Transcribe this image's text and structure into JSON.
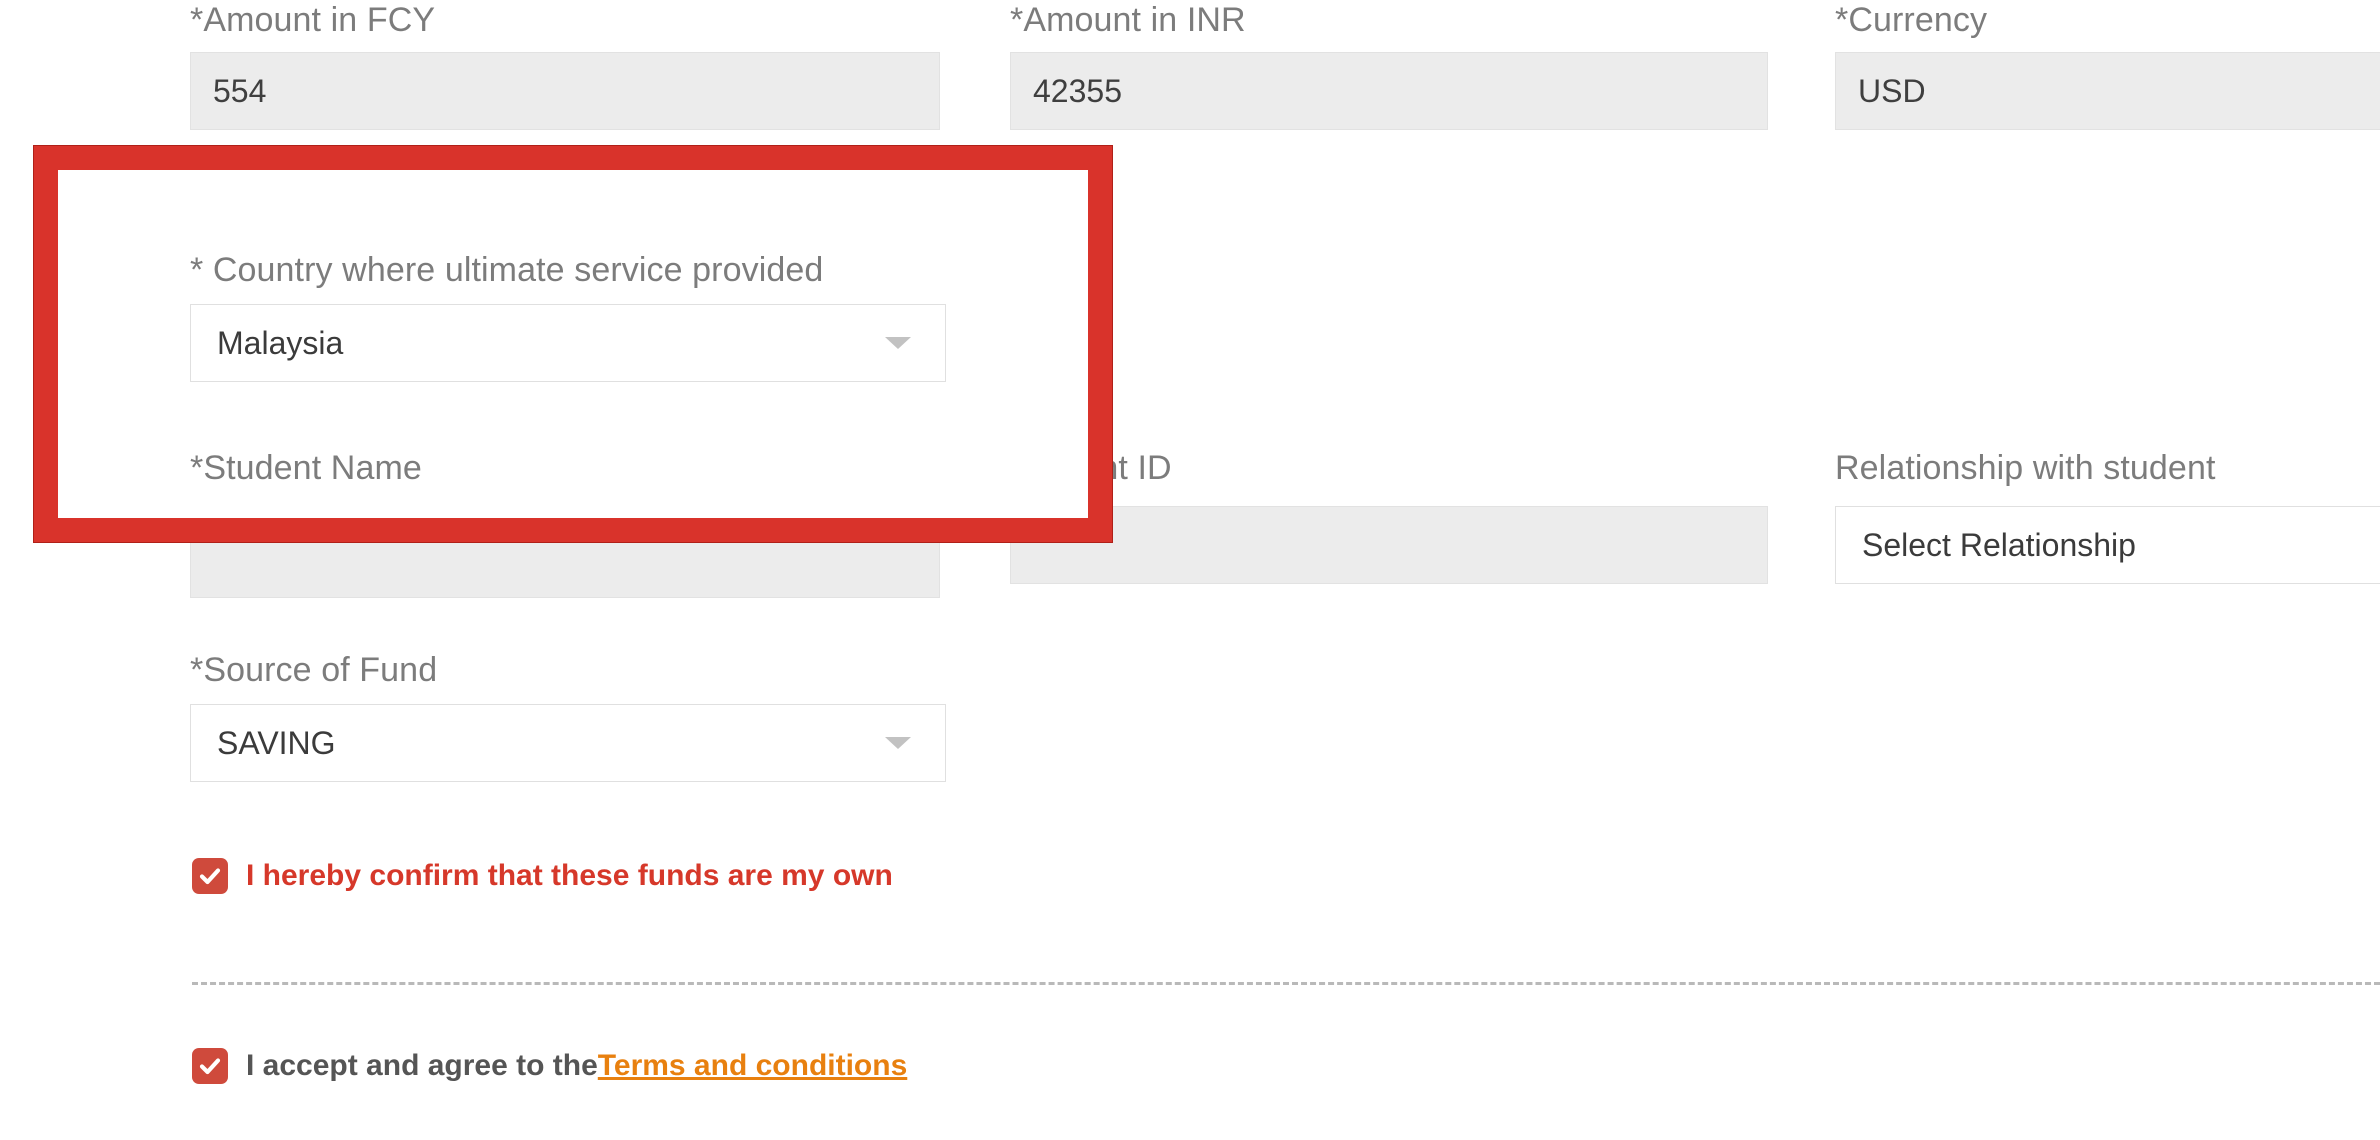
{
  "form": {
    "amount_fcy": {
      "label": "*Amount in FCY",
      "value": "554"
    },
    "amount_inr": {
      "label": "*Amount in INR",
      "value": "42355"
    },
    "currency": {
      "label": "*Currency",
      "value": "USD"
    },
    "country_service": {
      "label": "* Country where ultimate service provided",
      "value": "Malaysia"
    },
    "student_name": {
      "label": "*Student Name",
      "value": ""
    },
    "student_id": {
      "label": "Student ID",
      "value": ""
    },
    "relationship": {
      "label": "Relationship with student",
      "value": "Select Relationship"
    },
    "source_of_fund": {
      "label": "*Source of Fund",
      "value": "SAVING"
    }
  },
  "confirmations": {
    "own_funds": {
      "label": "I hereby confirm that these funds are my own",
      "checked": true
    },
    "terms": {
      "prefix": "I accept and agree to the ",
      "link_label": "Terms and conditions",
      "checked": true
    }
  },
  "icons": {
    "caret_down": "chevron-down-icon",
    "checkmark": "check-icon"
  },
  "colors": {
    "annotation_red": "#d9332b",
    "checkbox_red": "#cf4a3c",
    "confirm_text_red": "#d6382a",
    "terms_link_orange": "#e8800f",
    "label_grey": "#7c7c7c",
    "disabled_field_bg": "#ececec"
  }
}
